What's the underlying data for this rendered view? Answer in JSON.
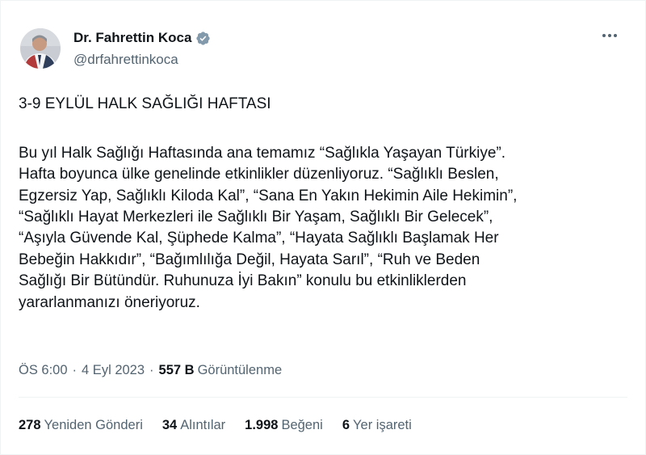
{
  "author": {
    "display_name": "Dr. Fahrettin Koca",
    "handle": "@drfahrettinkoca",
    "verified": true,
    "verified_color": "#829aab"
  },
  "tweet": {
    "title": "3-9 EYLÜL HALK SAĞLIĞI HAFTASI",
    "lines": [
      "Bu yıl Halk Sağlığı Haftasında ana temamız “Sağlıkla Yaşayan Türkiye”.",
      "Hafta boyunca ülke genelinde etkinlikler düzenliyoruz. “Sağlıklı Beslen,",
      "Egzersiz Yap, Sağlıklı Kiloda Kal”, “Sana En Yakın Hekimin Aile Hekimin”,",
      "“Sağlıklı Hayat Merkezleri ile Sağlıklı Bir Yaşam, Sağlıklı Bir Gelecek”,",
      "“Aşıyla Güvende Kal, Şüphede Kalma”, “Hayata Sağlıklı Başlamak Her",
      "Bebeğin Hakkıdır”, “Bağımlılığa Değil, Hayata Sarıl”, “Ruh ve Beden",
      "Sağlığı Bir Bütündür. Ruhunuza İyi Bakın” konulu bu etkinliklerden",
      "yararlanmanızı öneriyoruz."
    ]
  },
  "meta": {
    "time": "ÖS 6:00",
    "separator": "·",
    "date": "4 Eyl 2023",
    "views_count": "557 B",
    "views_label": "Görüntülenme"
  },
  "stats": {
    "retweets_count": "278",
    "retweets_label": "Yeniden Gönderi",
    "quotes_count": "34",
    "quotes_label": "Alıntılar",
    "likes_count": "1.998",
    "likes_label": "Beğeni",
    "bookmarks_count": "6",
    "bookmarks_label": "Yer işareti"
  },
  "colors": {
    "text_primary": "#0f1419",
    "text_secondary": "#536471",
    "divider": "#eff3f4"
  },
  "icons": {
    "verified": "verified-badge-icon",
    "more": "more-horizontal-icon"
  }
}
